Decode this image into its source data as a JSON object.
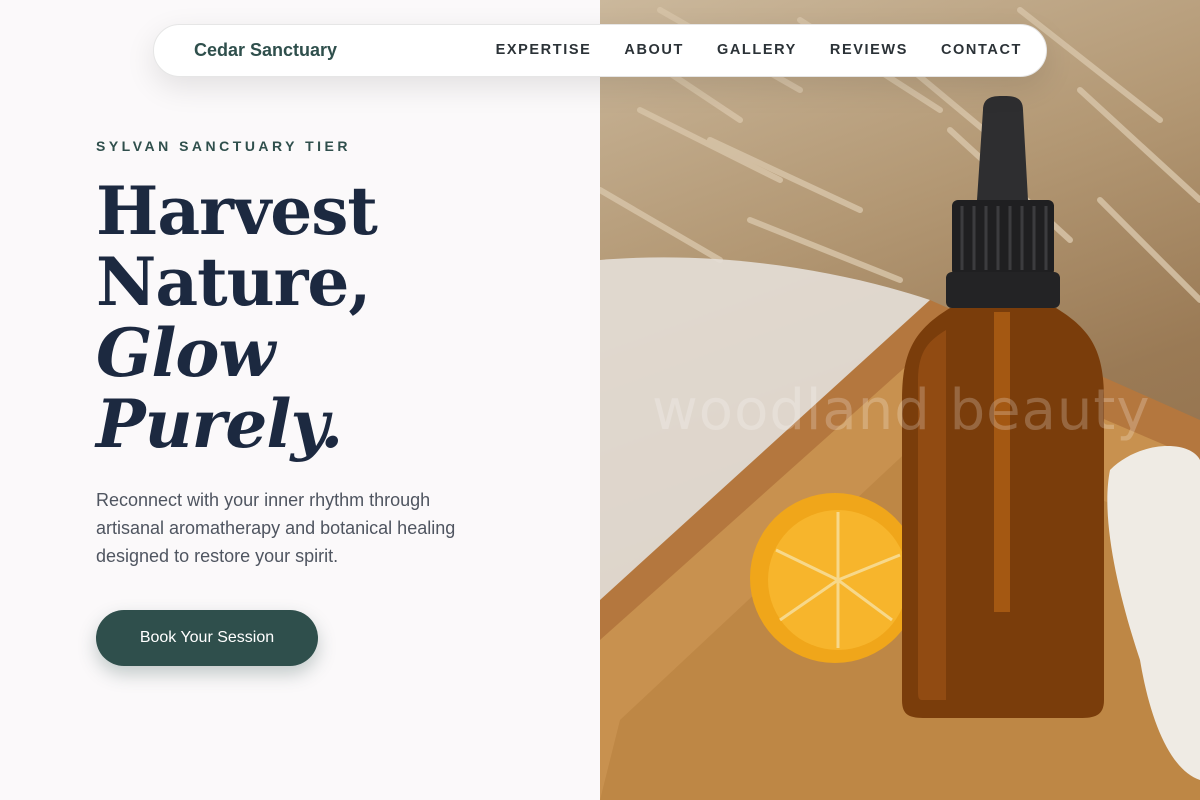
{
  "nav": {
    "brand": "Cedar Sanctuary",
    "links": [
      "EXPERTISE",
      "ABOUT",
      "GALLERY",
      "REVIEWS",
      "CONTACT"
    ]
  },
  "hero": {
    "eyebrow": "SYLVAN SANCTUARY TIER",
    "headline": [
      "Harvest",
      "Nature,",
      "Glow",
      "Purely."
    ],
    "lede": "Reconnect with your inner rhythm through artisanal aromatherapy and botanical healing designed to restore your spirit.",
    "cta_label": "Book Your Session",
    "image_watermark": "woodland beauty"
  },
  "colors": {
    "accent": "#2f4f4c",
    "headline": "#1c2940",
    "background": "#fbf9fa"
  }
}
